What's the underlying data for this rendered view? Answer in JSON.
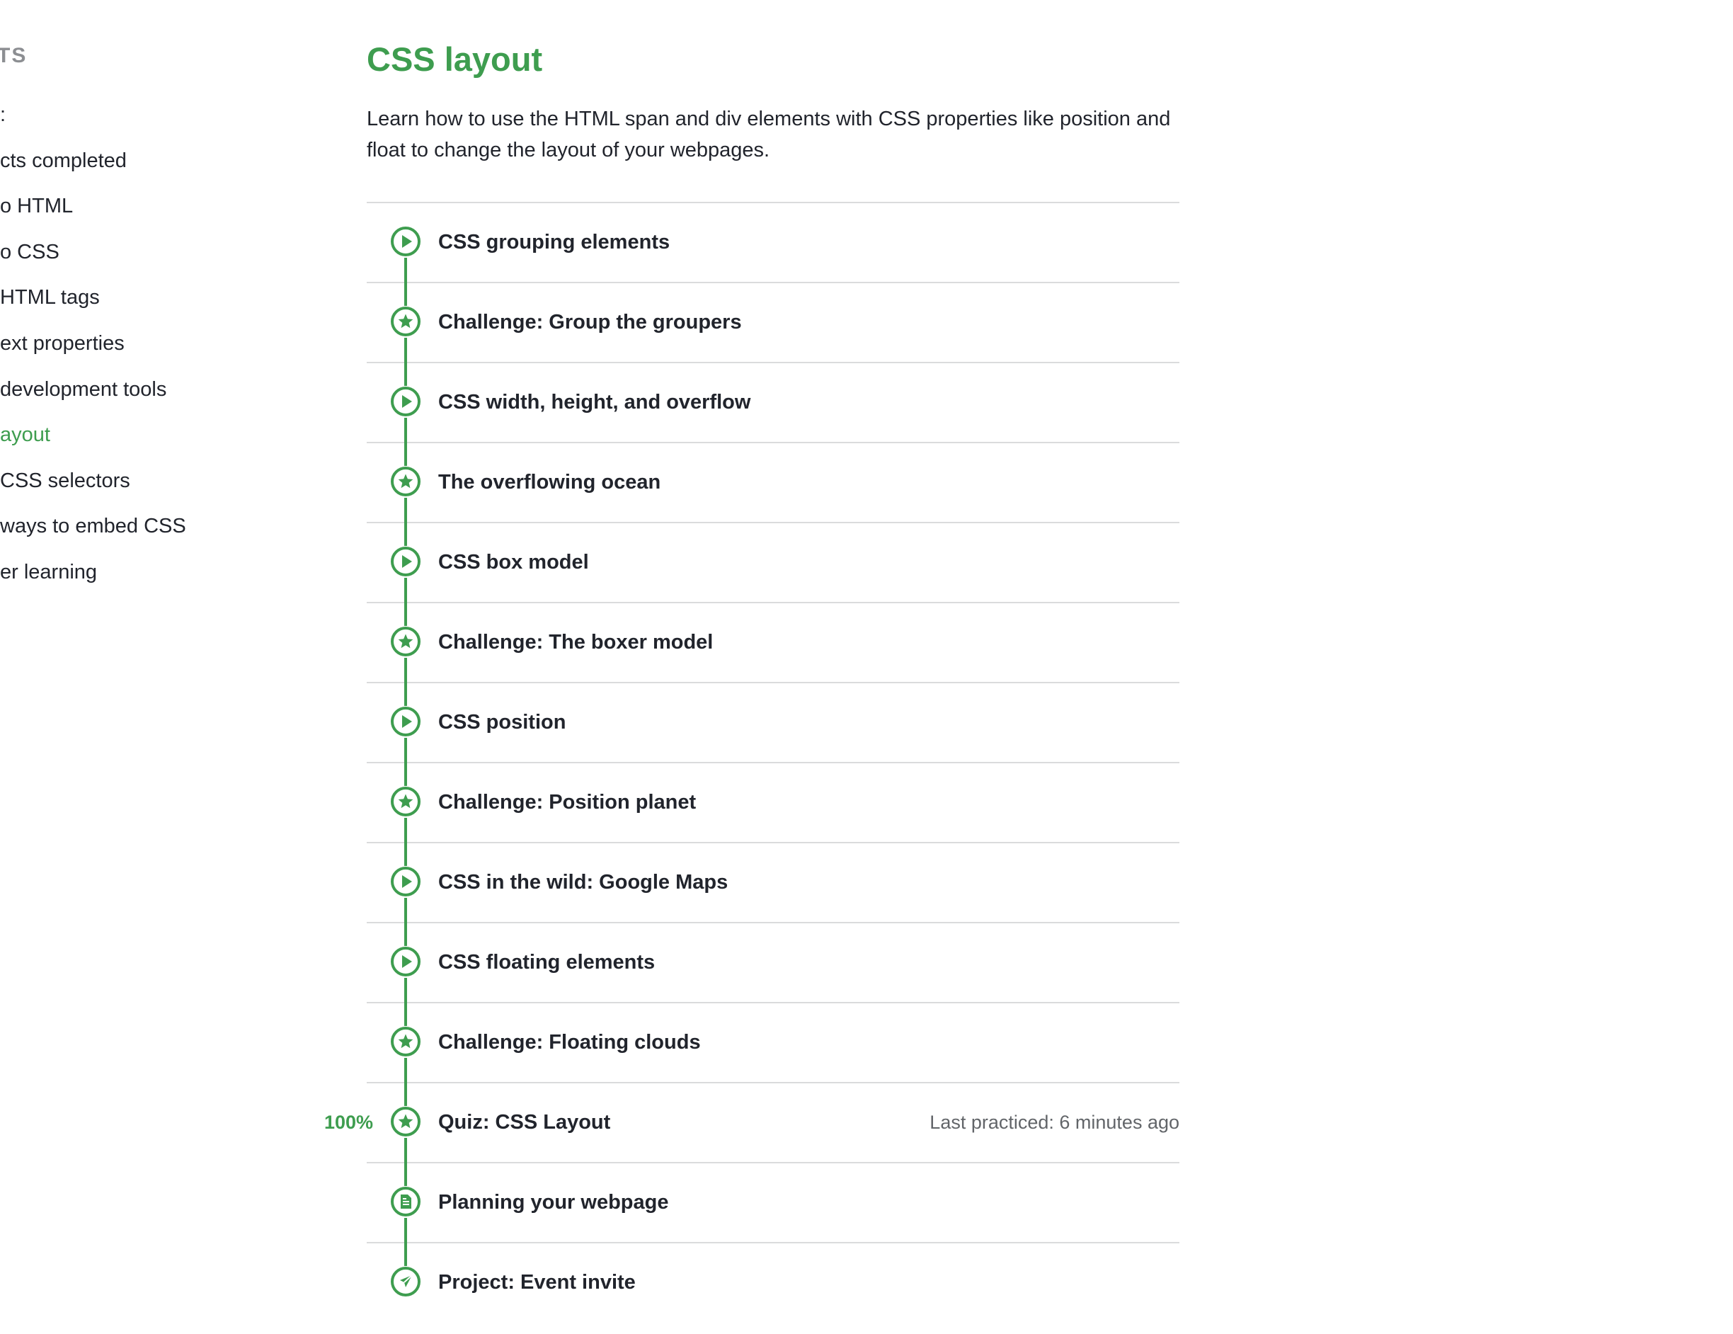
{
  "sidebar": {
    "heading": "TENTS",
    "items": [
      {
        "label": ":",
        "active": false
      },
      {
        "label": "cts completed",
        "active": false
      },
      {
        "label": "o HTML",
        "active": false
      },
      {
        "label": "o CSS",
        "active": false
      },
      {
        "label": "HTML tags",
        "active": false
      },
      {
        "label": "ext properties",
        "active": false
      },
      {
        "label": "development tools",
        "active": false
      },
      {
        "label": "ayout",
        "active": true
      },
      {
        "label": "CSS selectors",
        "active": false
      },
      {
        "label": " ways to embed CSS",
        "active": false
      },
      {
        "label": "er learning",
        "active": false
      }
    ]
  },
  "main": {
    "title": "CSS layout",
    "description": "Learn how to use the HTML span and div elements with CSS properties like position and float to change the layout of your webpages.",
    "lessons": [
      {
        "title": "CSS grouping elements",
        "icon": "play-icon"
      },
      {
        "title": "Challenge: Group the groupers",
        "icon": "star-icon"
      },
      {
        "title": "CSS width, height, and overflow",
        "icon": "play-icon"
      },
      {
        "title": "The overflowing ocean",
        "icon": "star-icon"
      },
      {
        "title": "CSS box model",
        "icon": "play-icon"
      },
      {
        "title": "Challenge: The boxer model",
        "icon": "star-icon"
      },
      {
        "title": "CSS position",
        "icon": "play-icon"
      },
      {
        "title": "Challenge: Position planet",
        "icon": "star-icon"
      },
      {
        "title": "CSS in the wild: Google Maps",
        "icon": "play-icon"
      },
      {
        "title": "CSS floating elements",
        "icon": "play-icon"
      },
      {
        "title": "Challenge: Floating clouds",
        "icon": "star-icon"
      },
      {
        "title": "Quiz: CSS Layout",
        "icon": "star-icon",
        "score": "100%",
        "meta": "Last practiced: 6 minutes ago"
      },
      {
        "title": "Planning your webpage",
        "icon": "document-icon"
      },
      {
        "title": "Project: Event invite",
        "icon": "rocket-icon"
      }
    ]
  },
  "colors": {
    "accent": "#3e9d4f",
    "text": "#21242c",
    "muted": "#626569",
    "divider": "#dadbdc"
  }
}
